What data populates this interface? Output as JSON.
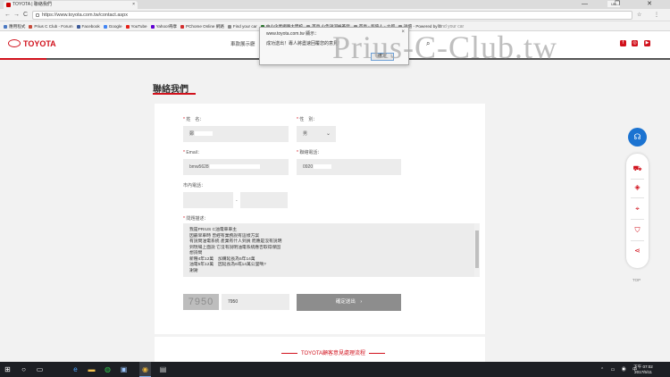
{
  "browser": {
    "tab_title": "TOYOTA | 聯絡我們",
    "tab_close": "×",
    "window_controls": "— ❐ ✕",
    "user_chip": "UR",
    "url": "https://www.toyota.com.tw/contact.aspx",
    "nav_back": "←",
    "nav_forward": "→",
    "nav_reload": "C",
    "addr_icons": "☆ ⋮"
  },
  "bookmarks": [
    {
      "label": "應用程式",
      "color": "#4a78c2"
    },
    {
      "label": "Prius C Club - Forum",
      "color": "#c84b3a"
    },
    {
      "label": "Facebook",
      "color": "#3b5998"
    },
    {
      "label": "Google",
      "color": "#4285f4"
    },
    {
      "label": "YouTube",
      "color": "#e62117"
    },
    {
      "label": "Yahoo!奇摩",
      "color": "#6001d2"
    },
    {
      "label": "PChome Online 網路",
      "color": "#d32f2f"
    },
    {
      "label": "Find your car",
      "color": "#888888"
    },
    {
      "label": "中小企業網路大學校",
      "color": "#2e7d32"
    },
    {
      "label": "首頁 小告訴河裕茶發",
      "color": "#888888"
    },
    {
      "label": "首頁 - 超值人 - 立即",
      "color": "#888888"
    },
    {
      "label": "論壇 - Powered by D",
      "color": "#888888"
    }
  ],
  "header": {
    "logo_text": "TOYOTA",
    "nav_text": "車款展示廳",
    "search_icon": "⌕",
    "social": [
      {
        "name": "facebook-icon",
        "glyph": "f",
        "color": "#d1111c"
      },
      {
        "name": "instagram-icon",
        "glyph": "◎",
        "color": "#d1111c"
      },
      {
        "name": "youtube-icon",
        "glyph": "▶",
        "color": "#d1111c"
      }
    ]
  },
  "dialog": {
    "title": "www.toyota.com.tw 顯示：",
    "close": "×",
    "message": "成功送出！專人將盡速回覆您的意見！",
    "ok_label": "確定",
    "ghost_text": "Find your car"
  },
  "watermark": "Prius-C-Club.tw",
  "page": {
    "title": "聯絡我們"
  },
  "form": {
    "name_label": "姓　名：",
    "name_value": "鄭",
    "gender_label": "性　別：",
    "gender_value": "男",
    "email_label": "Email：",
    "email_value": "bmw5628",
    "phone_label": "聯絡電話：",
    "phone_value": "0920",
    "landline_label": "市內電話：",
    "landline_sep": "-",
    "message_label": "問題描述：",
    "message_lines": [
      "我是PRIUS C油電車車主",
      "因最早車時 曾經有業務說有這樣方案",
      "有說問油電系統 產業有什人到員 而應是沒有說明",
      "到現場上面說 它沒有說明油電系統應否取得保固",
      "想詢問",
      "新種4年12萬　加購延長為5年14萬",
      "油電5年12萬　因延長為6或14萬公里嗎?",
      "謝謝"
    ],
    "captcha_image_text": "7950",
    "captcha_value": "7950",
    "submit_label": "確定送出",
    "submit_arrow": "›",
    "required_mark": "*"
  },
  "bottom_section_title": "TOYOTA顧客意見處理流程",
  "side_widget": {
    "support_icon": "☊",
    "icons": [
      {
        "name": "car-icon",
        "glyph": "⛟"
      },
      {
        "name": "price-tag-icon",
        "glyph": "◈"
      },
      {
        "name": "location-icon",
        "glyph": "⌖"
      },
      {
        "name": "dealer-icon",
        "glyph": "⛉"
      },
      {
        "name": "share-icon",
        "glyph": "⋖"
      }
    ],
    "top_label": "TOP"
  },
  "taskbar": {
    "clock_time": "下午 07:02",
    "clock_date": "2017/5/11",
    "tray": "⌃ ▭ ◉ 中"
  }
}
